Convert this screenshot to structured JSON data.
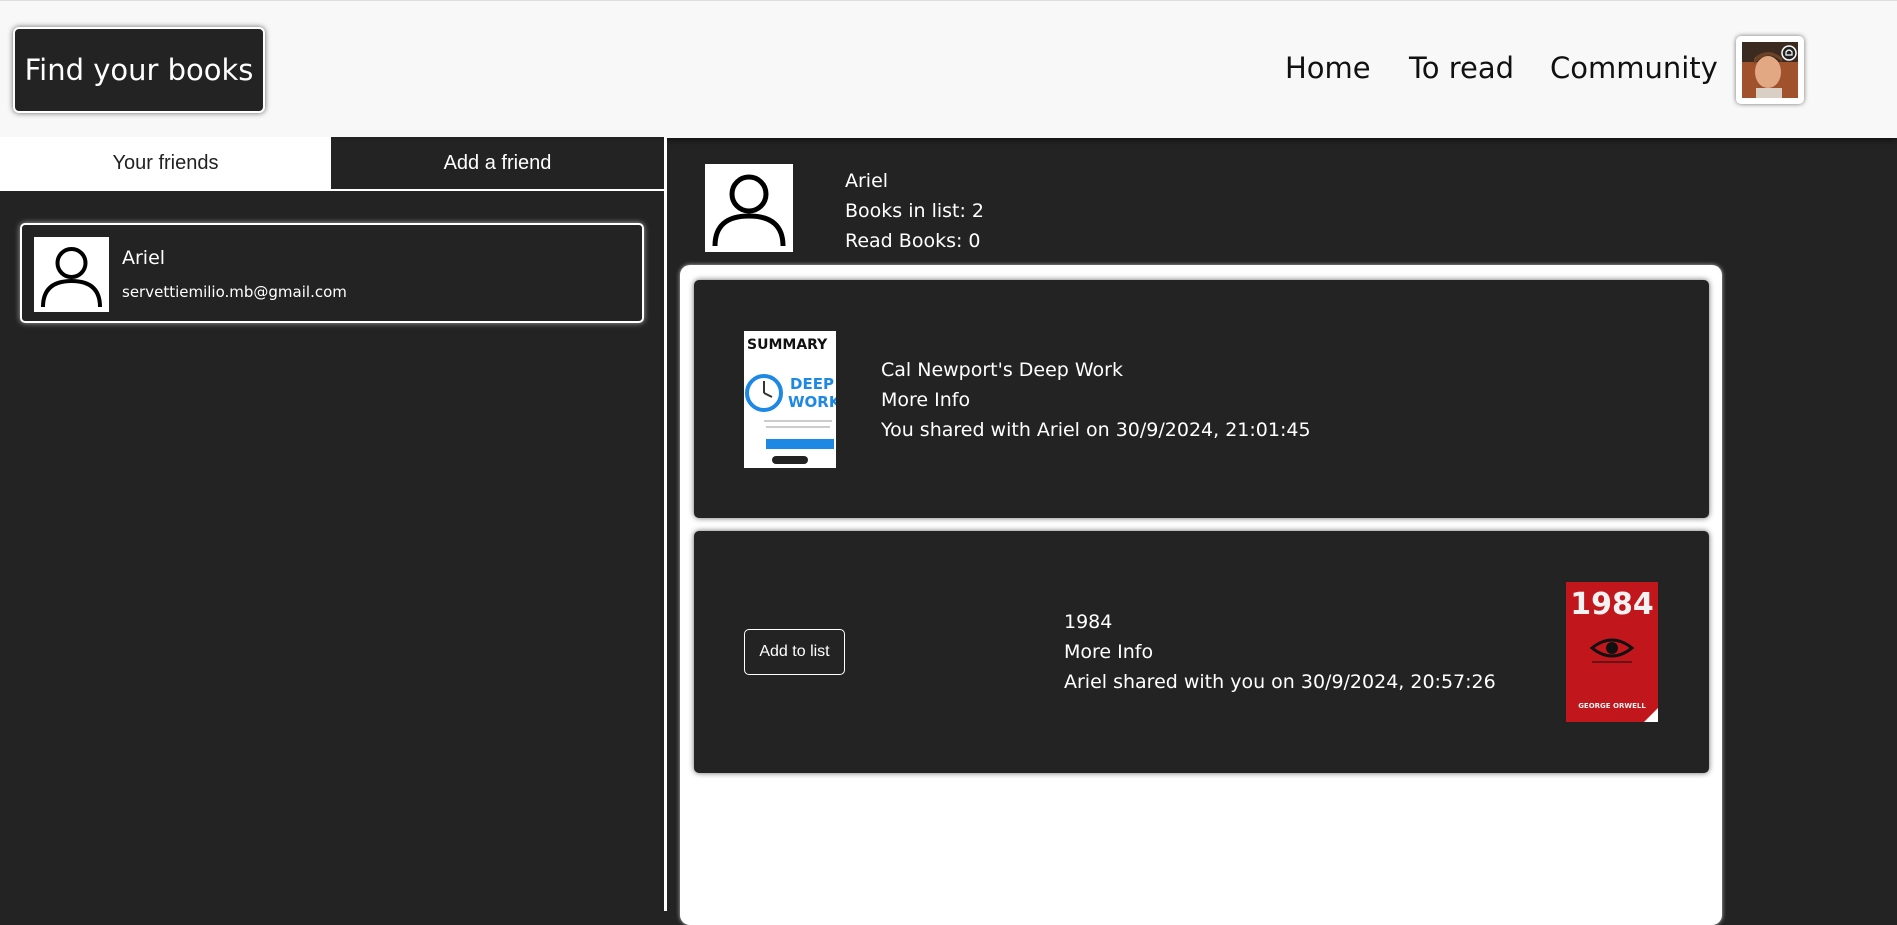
{
  "header": {
    "brand": "Find your books",
    "nav": {
      "home": "Home",
      "to_read": "To read",
      "community": "Community"
    }
  },
  "friends_panel": {
    "tabs": {
      "friends": "Your friends",
      "add": "Add a friend"
    },
    "friends": [
      {
        "name": "Ariel",
        "email": "servettiemilio.mb@gmail.com"
      }
    ]
  },
  "profile": {
    "name": "Ariel",
    "books_in_list": "Books in list: 2",
    "read_books": "Read Books: 0"
  },
  "books": [
    {
      "title": "Cal Newport's Deep Work",
      "more_info": "More Info",
      "shared": "You shared with Ariel on 30/9/2024, 21:01:45",
      "cover": {
        "line1": "SUMMARY",
        "line2": "DEEP",
        "line3": "WORK",
        "accent": "#1e88e5"
      }
    },
    {
      "title": "1984",
      "more_info": "More Info",
      "shared": "Ariel shared with you on 30/9/2024, 20:57:26",
      "add_label": "Add to list",
      "cover": {
        "title": "1984",
        "author": "GEORGE ORWELL",
        "bg": "#c0161c"
      }
    }
  ]
}
